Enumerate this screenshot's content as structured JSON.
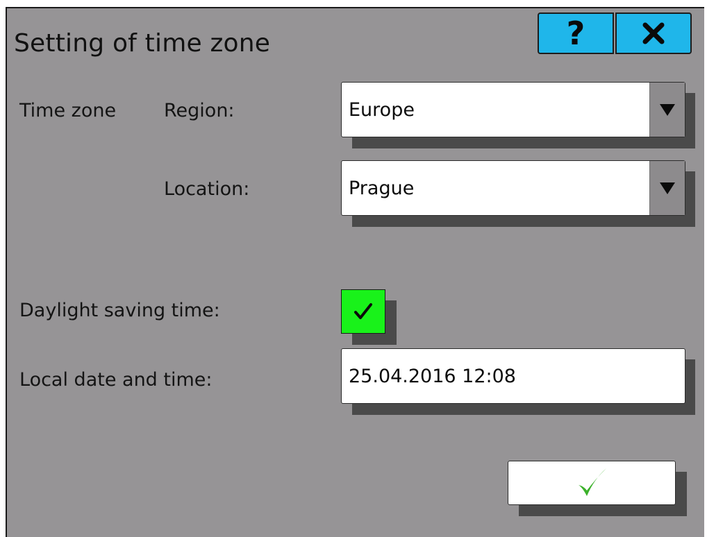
{
  "dialog": {
    "title": "Setting of time zone",
    "help_label": "?",
    "close_icon": "close-icon"
  },
  "form": {
    "time_zone_label": "Time zone",
    "region_label": "Region:",
    "region_value": "Europe",
    "location_label": "Location:",
    "location_value": "Prague",
    "dst_label": "Daylight saving time:",
    "dst_checked": true,
    "datetime_label": "Local date and time:",
    "datetime_value": "25.04.2016 12:08"
  },
  "confirm": {
    "icon": "checkmark-icon"
  },
  "colors": {
    "background": "#969496",
    "top_button": "#1fb6ea",
    "checkbox_checked": "#19f21a",
    "confirm_check": "#3bb12a"
  }
}
